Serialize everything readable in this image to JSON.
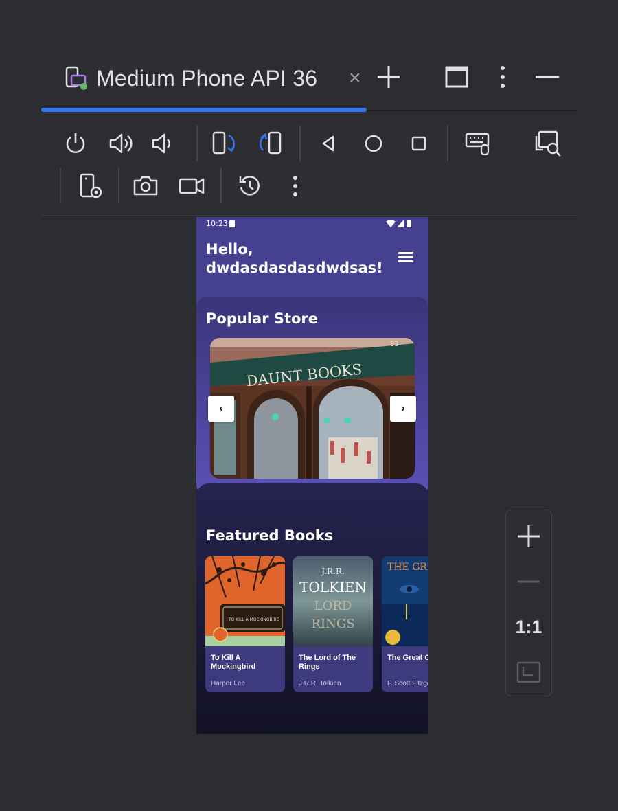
{
  "window": {
    "tab_title": "Medium Phone API 36",
    "tab_close": "×"
  },
  "toolbar": {
    "items": [
      "power-icon",
      "volume-up-icon",
      "volume-down-icon",
      "rotate-left-icon",
      "rotate-right-icon",
      "back-icon",
      "home-icon",
      "overview-icon",
      "keyboard-icon",
      "inspect-icon",
      "device-settings-icon",
      "screenshot-icon",
      "screen-record-icon",
      "snapshot-icon",
      "more-icon"
    ]
  },
  "phone": {
    "status_time": "10:23",
    "greeting": "Hello, dwdasdasdasdwdsas!",
    "popular_title": "Popular Store",
    "carousel_prev": "‹",
    "carousel_next": "›",
    "featured_title": "Featured Books",
    "books": [
      {
        "title": "To Kill A Mockingbird",
        "author": "Harper Lee",
        "cover_text": "TO KILL A MOCKINGBIRD"
      },
      {
        "title": "The Lord of The Rings",
        "author": "J.R.R. Tolkien",
        "cover_text_1": "J.R.R.",
        "cover_text_2": "TOLKIEN",
        "cover_text_3": "LORD",
        "cover_text_4": "RINGS"
      },
      {
        "title": "The Great Gatsby",
        "author": "F. Scott Fitzgerald",
        "cover_text": "THE GREAT GATSBY"
      }
    ],
    "store_sign": "DAUNT BOOKS",
    "store_number": "83"
  },
  "zoom": {
    "reset_label": "1:1"
  },
  "colors": {
    "accent": "#3574f0",
    "background": "#2b2d30",
    "phone_header": "#45408f"
  }
}
